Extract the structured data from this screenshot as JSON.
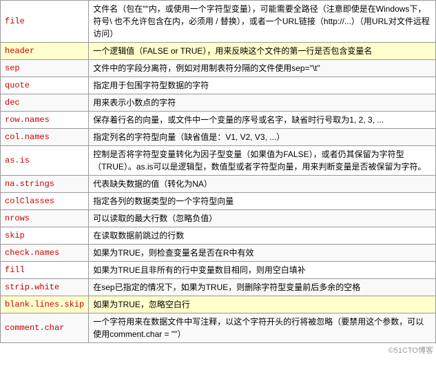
{
  "table": {
    "rows": [
      {
        "param": "file",
        "desc": "文件名（包在\"\"内，或使用一个字符型变量），可能需要全路径（注意即使是在Windows下，符号\\ 也不允许包含在内，必须用 / 替换），或者一个URL链接（http://...）（用URL对文件远程访问）",
        "highlight": false
      },
      {
        "param": "header",
        "desc": "一个逻辑值（FALSE or TRUE），用来反映这个文件的第一行是否包含变量名",
        "highlight": true
      },
      {
        "param": "sep",
        "desc": "文件中的字段分离符，例如对用制表符分隔的文件使用sep=\"\\t\"",
        "highlight": false
      },
      {
        "param": "quote",
        "desc": "指定用于包围字符型数据的字符",
        "highlight": false
      },
      {
        "param": "dec",
        "desc": "用来表示小数点的字符",
        "highlight": false
      },
      {
        "param": "row.names",
        "desc": "保存着行名的向量，或文件中一个变量的序号或名字，缺省时行号取为1, 2, 3, ...",
        "highlight": false
      },
      {
        "param": "col.names",
        "desc": "指定列名的字符型向量（缺省值是：V1, V2, V3, ...）",
        "highlight": false
      },
      {
        "param": "as.is",
        "desc": "控制是否将字符型变量转化为因子型变量（如果值为FALSE），或者仍其保留为字符型（TRUE）。as.is可以是逻辑型，数值型或者字符型向量，用来判断变量是否被保留为字符。",
        "highlight": false
      },
      {
        "param": "na.strings",
        "desc": "代表缺失数据的值（转化为NA）",
        "highlight": false
      },
      {
        "param": "colClasses",
        "desc": "指定各列的数据类型的一个字符型向量",
        "highlight": false
      },
      {
        "param": "nrows",
        "desc": "可以读取的最大行数（忽略负值）",
        "highlight": false
      },
      {
        "param": "skip",
        "desc": "在读取数据前跳过的行数",
        "highlight": false
      },
      {
        "param": "check.names",
        "desc": "如果为TRUE，则检查变量名是否在R中有效",
        "highlight": false
      },
      {
        "param": "fill",
        "desc": "如果为TRUE且非所有的行中变量数目相同，则用空白填补",
        "highlight": false
      },
      {
        "param": "strip.white",
        "desc": "在sep已指定的情况下，如果为TRUE，则删除字符型变量前后多余的空格",
        "highlight": false
      },
      {
        "param": "blank.lines.skip",
        "desc": "如果为TRUE，忽略空白行",
        "highlight": true
      },
      {
        "param": "comment.char",
        "desc": "一个字符用来在数据文件中写注释，以这个字符开头的行将被忽略（要禁用这个参数，可以使用comment.char = \"\"）",
        "highlight": false
      }
    ],
    "footer": "©51CTO博客"
  }
}
